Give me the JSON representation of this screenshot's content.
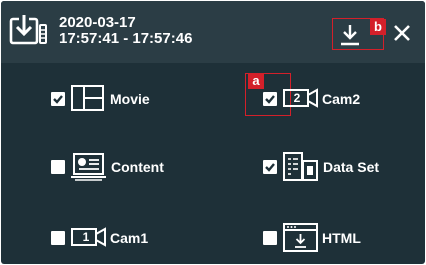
{
  "header": {
    "date": "2020-03-17",
    "time_range": "17:57:41 - 17:57:46",
    "export_icon": "export-download-icon",
    "download_icon": "download-icon",
    "close_icon": "close-icon"
  },
  "callouts": {
    "a": "a",
    "b": "b"
  },
  "options": {
    "movie": {
      "label": "Movie",
      "checked": true,
      "icon": "layout-icon"
    },
    "content": {
      "label": "Content",
      "checked": false,
      "icon": "monitor-report-icon"
    },
    "cam1": {
      "label": "Cam1",
      "checked": false,
      "icon": "camera-icon",
      "badge": "1"
    },
    "cam2": {
      "label": "Cam2",
      "checked": true,
      "icon": "camera-icon",
      "badge": "2"
    },
    "dataset": {
      "label": "Data Set",
      "checked": true,
      "icon": "dataset-icon"
    },
    "html": {
      "label": "HTML",
      "checked": false,
      "icon": "html-download-icon"
    }
  },
  "colors": {
    "panel": "#1e3038",
    "header": "#2b3d45",
    "accent_red": "#d3202a",
    "text": "#ffffff"
  }
}
